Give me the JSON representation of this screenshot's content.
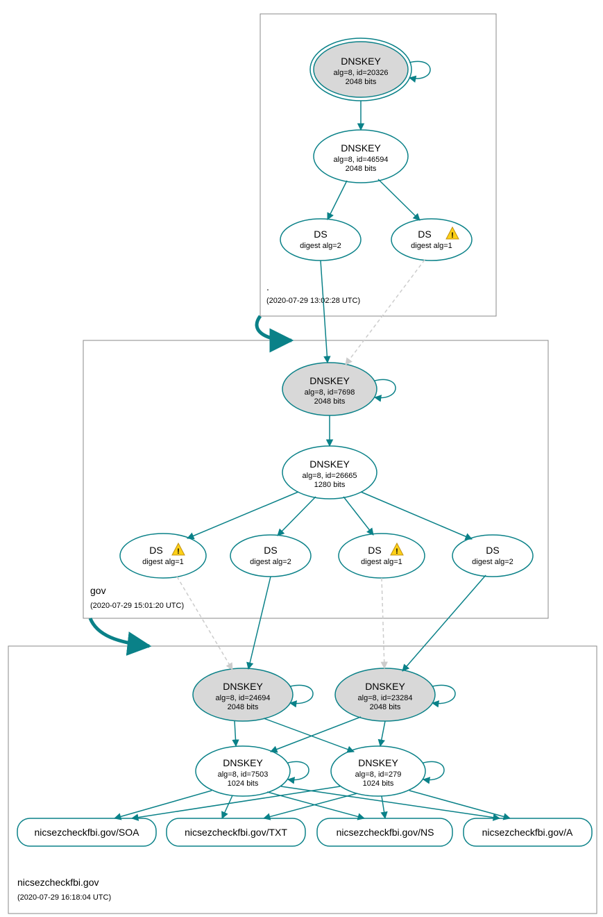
{
  "zones": {
    "root": {
      "label": ".",
      "timestamp": "(2020-07-29 13:02:28 UTC)"
    },
    "gov": {
      "label": "gov",
      "timestamp": "(2020-07-29 15:01:20 UTC)"
    },
    "domain": {
      "label": "nicsezcheckfbi.gov",
      "timestamp": "(2020-07-29 16:18:04 UTC)"
    }
  },
  "nodes": {
    "root_ksk": {
      "title": "DNSKEY",
      "alg": "alg=8, id=20326",
      "bits": "2048 bits"
    },
    "root_zsk": {
      "title": "DNSKEY",
      "alg": "alg=8, id=46594",
      "bits": "2048 bits"
    },
    "root_ds1": {
      "title": "DS",
      "sub": "digest alg=2"
    },
    "root_ds2": {
      "title": "DS",
      "sub": "digest alg=1"
    },
    "gov_ksk": {
      "title": "DNSKEY",
      "alg": "alg=8, id=7698",
      "bits": "2048 bits"
    },
    "gov_zsk": {
      "title": "DNSKEY",
      "alg": "alg=8, id=26665",
      "bits": "1280 bits"
    },
    "gov_ds1": {
      "title": "DS",
      "sub": "digest alg=1"
    },
    "gov_ds2": {
      "title": "DS",
      "sub": "digest alg=2"
    },
    "gov_ds3": {
      "title": "DS",
      "sub": "digest alg=1"
    },
    "gov_ds4": {
      "title": "DS",
      "sub": "digest alg=2"
    },
    "dom_ksk1": {
      "title": "DNSKEY",
      "alg": "alg=8, id=24694",
      "bits": "2048 bits"
    },
    "dom_ksk2": {
      "title": "DNSKEY",
      "alg": "alg=8, id=23284",
      "bits": "2048 bits"
    },
    "dom_zsk1": {
      "title": "DNSKEY",
      "alg": "alg=8, id=7503",
      "bits": "1024 bits"
    },
    "dom_zsk2": {
      "title": "DNSKEY",
      "alg": "alg=8, id=279",
      "bits": "1024 bits"
    }
  },
  "records": {
    "soa": "nicsezcheckfbi.gov/SOA",
    "txt": "nicsezcheckfbi.gov/TXT",
    "ns": "nicsezcheckfbi.gov/NS",
    "a": "nicsezcheckfbi.gov/A"
  }
}
